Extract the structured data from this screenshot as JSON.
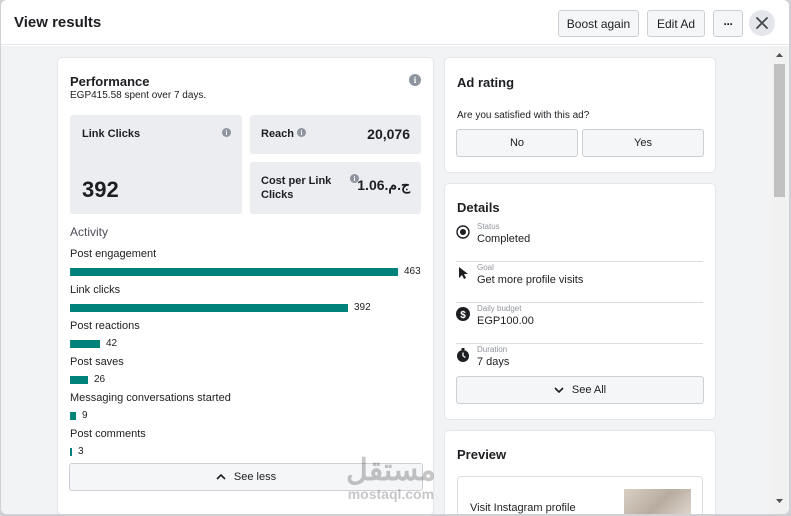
{
  "header": {
    "title": "View results",
    "boost_again": "Boost again",
    "edit_ad": "Edit Ad",
    "more": "···",
    "close": "✕"
  },
  "performance": {
    "title": "Performance",
    "subtitle": "EGP415.58 spent over 7 days.",
    "link_clicks": {
      "label": "Link Clicks",
      "value": "392"
    },
    "reach": {
      "label": "Reach",
      "value": "20,076"
    },
    "cost_per_link_click": {
      "label": "Cost per Link Clicks",
      "value": "ج.م.1.06"
    }
  },
  "activity": {
    "title": "Activity",
    "items": [
      {
        "label": "Post engagement",
        "value": "463",
        "fraction": 1.0
      },
      {
        "label": "Link clicks",
        "value": "392",
        "fraction": 0.847
      },
      {
        "label": "Post reactions",
        "value": "42",
        "fraction": 0.091
      },
      {
        "label": "Post saves",
        "value": "26",
        "fraction": 0.056
      },
      {
        "label": "Messaging conversations started",
        "value": "9",
        "fraction": 0.019
      },
      {
        "label": "Post comments",
        "value": "3",
        "fraction": 0.006
      }
    ],
    "see_less": "See less"
  },
  "ad_rating": {
    "title": "Ad rating",
    "question": "Are you satisfied with this ad?",
    "no": "No",
    "yes": "Yes"
  },
  "details": {
    "title": "Details",
    "rows": [
      {
        "label": "Status",
        "value": "Completed",
        "icon": "status-icon"
      },
      {
        "label": "Goal",
        "value": "Get more profile visits",
        "icon": "cursor-icon"
      },
      {
        "label": "Daily budget",
        "value": "EGP100.00",
        "icon": "dollar-icon"
      },
      {
        "label": "Duration",
        "value": "7 days",
        "icon": "stopwatch-icon"
      }
    ],
    "see_all": "See All"
  },
  "preview": {
    "title": "Preview",
    "link_text": "Visit Instagram profile"
  },
  "watermark": {
    "text": "مستقل",
    "sub": "mostaql.com"
  },
  "colors": {
    "bar": "#00817a",
    "accent": "#1c1e21"
  }
}
